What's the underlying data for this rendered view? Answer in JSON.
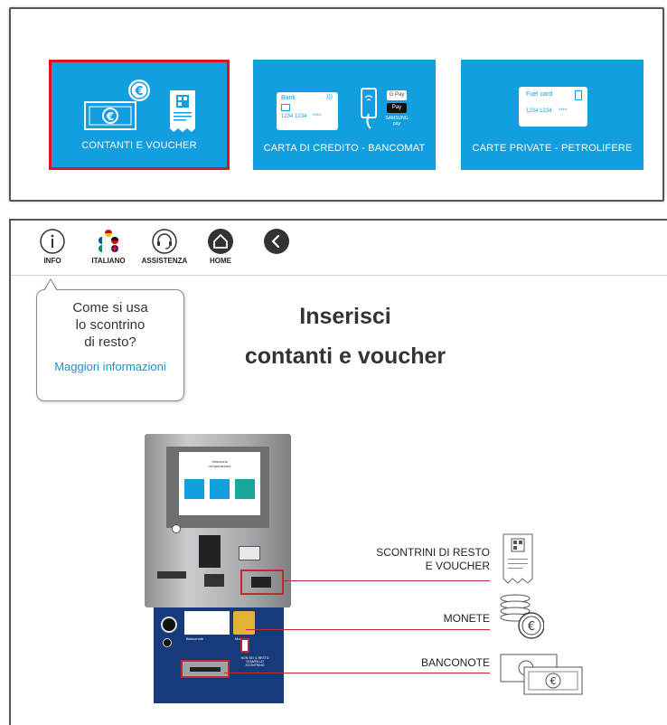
{
  "payment_methods": [
    {
      "label": "CONTANTI E VOUCHER",
      "selected": true
    },
    {
      "label": "CARTA DI CREDITO - BANCOMAT",
      "selected": false
    },
    {
      "label": "CARTE PRIVATE - PETROLIFERE",
      "selected": false
    }
  ],
  "card_art": {
    "bank": "Bank",
    "card_number": "1234 1234",
    "mask": "****",
    "gpay": "G Pay",
    "apple_pay": "Pay",
    "samsung_pay": "SAMSUNG pay",
    "fuel_card": "Fuel card"
  },
  "toolbar": {
    "info": "INFO",
    "language": "ITALIANO",
    "support": "ASSISTENZA",
    "home": "HOME"
  },
  "tooltip": {
    "question": "Come si usa\nlo scontrino\ndi resto?",
    "link": "Maggiori informazioni"
  },
  "main": {
    "title_line1": "Inserisci",
    "title_line2": "contanti e voucher"
  },
  "machine": {
    "screen_title": "Seleziona\nun'operazione",
    "callout_receipts": "SCONTRINI DI RESTO\nE VOUCHER",
    "callout_coins": "MONETE",
    "callout_notes": "BANCONOTE",
    "panel_banconote": "Banconote",
    "panel_monete": "Monete",
    "panel_note": "NON SEI IL RESTO\nSTAMPA LO SCONTRINO"
  },
  "colors": {
    "tile_blue": "#139ee0",
    "selected_border": "#e3121b",
    "callout_red": "#c0292f",
    "link_blue": "#1b8fd0"
  },
  "icons": [
    "cash-icon",
    "euro-coin-icon",
    "receipt-icon",
    "credit-card-icon",
    "phone-pay-icon",
    "fuel-card-icon",
    "info-icon",
    "flags-icon",
    "headset-icon",
    "home-icon",
    "back-icon"
  ]
}
